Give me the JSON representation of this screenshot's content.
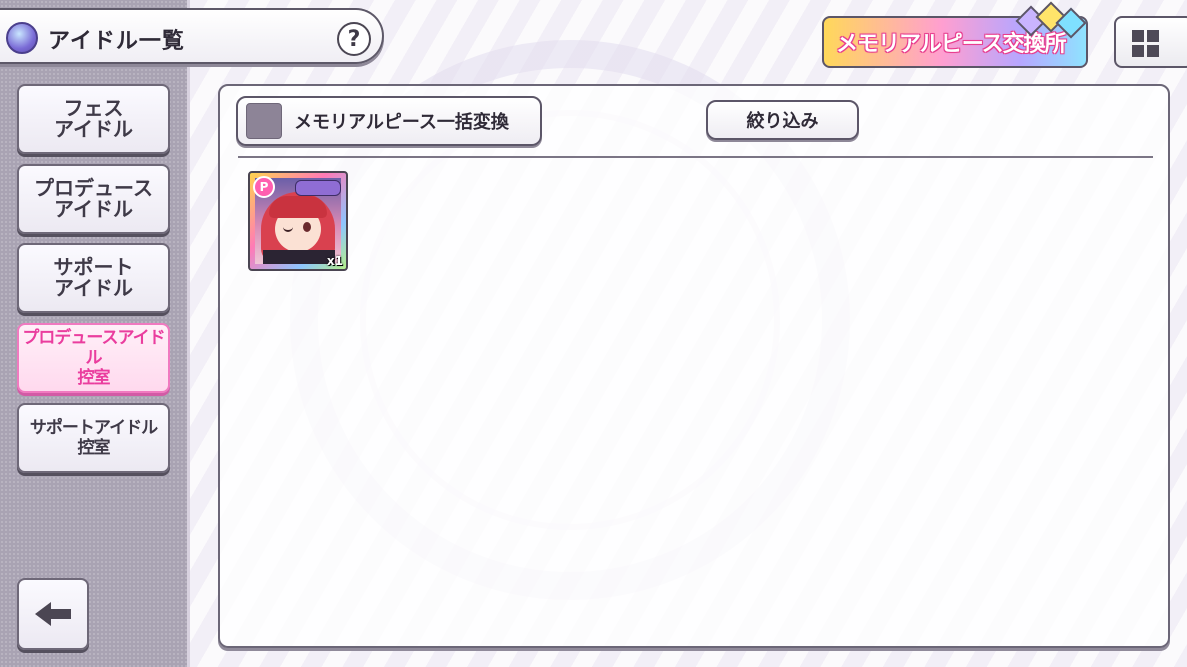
{
  "header": {
    "title": "アイドル一覧",
    "help_label": "?",
    "exchange_label": "メモリアルピース交換所"
  },
  "sidebar": {
    "items": [
      {
        "label": "フェス\nアイドル",
        "active": false
      },
      {
        "label": "プロデュース\nアイドル",
        "active": false
      },
      {
        "label": "サポート\nアイドル",
        "active": false
      },
      {
        "label": "プロデュースアイドル\n控室",
        "active": true
      },
      {
        "label": "サポートアイドル\n控室",
        "active": false
      }
    ]
  },
  "toolbar": {
    "bulk_convert_label": "メモリアルピース一括変換",
    "filter_label": "絞り込み"
  },
  "cards": [
    {
      "badge": "P",
      "count": "x1"
    }
  ],
  "colors": {
    "accent_pink": "#ea3d9e",
    "sidebar_bg": "#a9a3b3",
    "border": "#5c5668"
  },
  "icons": {
    "help": "question-icon",
    "grid": "grid-view-icon",
    "back": "arrow-left-icon",
    "title": "idol-emblem-icon"
  }
}
